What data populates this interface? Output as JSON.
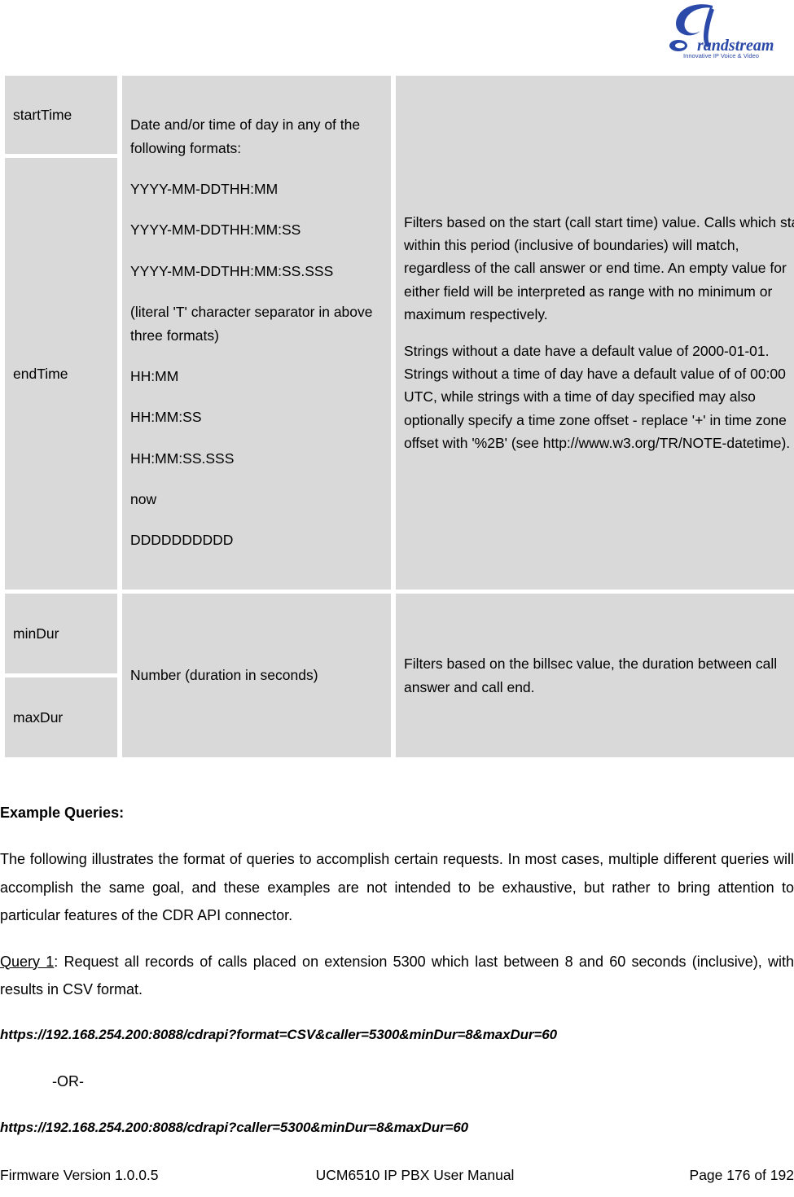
{
  "header": {
    "logo_name": "Grandstream",
    "logo_wordmark": "randstream",
    "logo_tagline": "Innovative IP Voice & Video",
    "logo_color": "#2a49a8"
  },
  "table": {
    "rows": [
      {
        "name": "startTime",
        "type_lines": [
          "Date and/or time of day in any of the following formats:"
        ],
        "description": []
      },
      {
        "name": "endTime",
        "type_lines": [
          "YYYY-MM-DDTHH:MM",
          "YYYY-MM-DDTHH:MM:SS",
          "YYYY-MM-DDTHH:MM:SS.SSS",
          "(literal 'T' character separator in above three formats)",
          "HH:MM",
          "HH:MM:SS",
          "HH:MM:SS.SSS",
          "now",
          "DDDDDDDDDD"
        ],
        "description": [
          "Filters based on the start (call start time) value. Calls which start within this period (inclusive of boundaries) will match, regardless of the call answer or end time. An empty value for either field will be interpreted as range with no minimum or maximum respectively.",
          "Strings without a date have a default value of 2000-01-01. Strings without a time of day have a default value of of 00:00 UTC, while strings with a time of day specified may also optionally specify a time zone offset - replace '+' in time zone offset with '%2B' (see http://www.w3.org/TR/NOTE-datetime)."
        ]
      },
      {
        "name": "minDur",
        "type_lines": [],
        "description": []
      },
      {
        "name": "maxDur",
        "type_lines": [
          "Number (duration in seconds)"
        ],
        "description": [
          "Filters based on the billsec value, the duration between call answer and call end."
        ]
      }
    ],
    "cell_background": "#d9d9d9"
  },
  "content": {
    "example_heading": "Example Queries:",
    "intro_paragraph": "The following illustrates the format of queries to accomplish certain requests. In most cases, multiple different queries will accomplish the same goal, and these examples are not intended to be exhaustive, but rather to bring attention to particular features of the CDR API connector.",
    "query1_label": "Query 1",
    "query1_text": ": Request all records of calls placed on extension 5300 which last between 8 and 60 seconds (inclusive), with results in CSV format.",
    "query1_url_a": "https://192.168.254.200:8088/cdrapi?format=CSV&caller=5300&minDur=8&maxDur=60",
    "or_separator": "-OR-",
    "query1_url_b": "https://192.168.254.200:8088/cdrapi?caller=5300&minDur=8&maxDur=60"
  },
  "footer": {
    "left": "Firmware Version 1.0.0.5",
    "center": "UCM6510 IP PBX User Manual",
    "right": "Page 176 of 192"
  }
}
